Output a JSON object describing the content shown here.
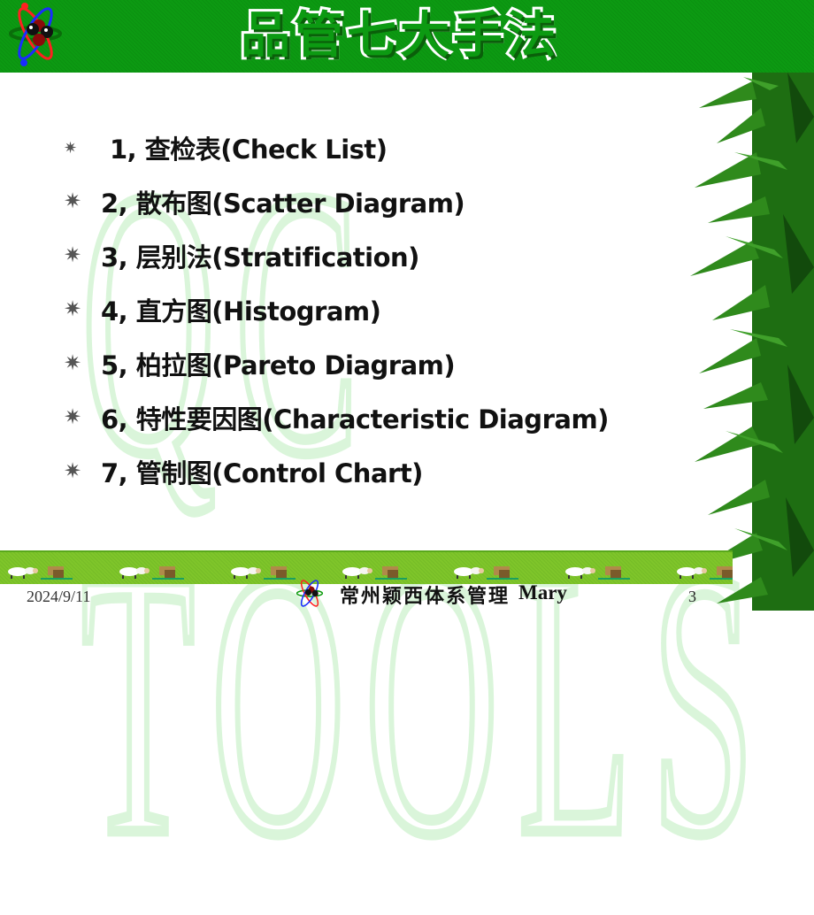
{
  "header": {
    "title": "品管七大手法",
    "background_color": "#0c9a12"
  },
  "watermark": "QC TOOLS",
  "items": [
    {
      "text": "1, 查检表(Check List)"
    },
    {
      "text": "2, 散布图(Scatter Diagram)"
    },
    {
      "text": "3, 层别法(Stratification)"
    },
    {
      "text": "4, 直方图(Histogram)"
    },
    {
      "text": "5, 柏拉图(Pareto Diagram)"
    },
    {
      "text": "6, 特性要因图(Characteristic Diagram)"
    },
    {
      "text": "7, 管制图(Control Chart)"
    }
  ],
  "bullet_icon": "✷",
  "footer": {
    "date": "2024/9/11",
    "organization": "常州颖西体系管理",
    "author": "Mary",
    "page_number": "3"
  }
}
